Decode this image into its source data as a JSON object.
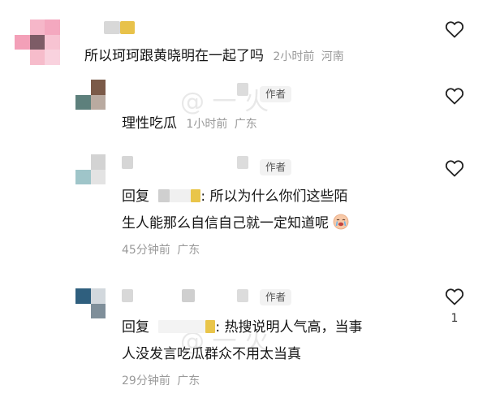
{
  "comments": [
    {
      "text": "所以珂珂跟黄晓明在一起了吗",
      "time": "2小时前",
      "location": "河南"
    },
    {
      "author_badge": "作者",
      "text": "理性吃瓜",
      "time": "1小时前",
      "location": "广东"
    },
    {
      "author_badge": "作者",
      "reply_prefix": "回复",
      "text_line1": ": 所以为什么你们这些陌",
      "text_line2": "生人能那么自信自己就一定知道呢",
      "time": "45分钟前",
      "location": "广东"
    },
    {
      "author_badge": "作者",
      "reply_prefix": "回复",
      "text_line1": ": 热搜说明人气高，当事",
      "text_line2": "人没发言吃瓜群众不用太当真",
      "time": "29分钟前",
      "location": "广东",
      "like_count": "1"
    }
  ],
  "colors": {
    "avatar1": [
      "#f4b4c8",
      "#7c5c66",
      "#f2a3bb"
    ],
    "avatar2": [
      "#7b5a48",
      "#5b7f7b",
      "#d9d0c9"
    ],
    "avatar3": [
      "#cfcfcf",
      "#9fc4c8",
      "#e0e0e0"
    ],
    "avatar4": [
      "#2f5f7e",
      "#7f8f9a",
      "#cfd6dc"
    ],
    "name_highlight": "#e9c54a"
  },
  "icons": [
    "heart-icon",
    "crying-face-emoji"
  ]
}
